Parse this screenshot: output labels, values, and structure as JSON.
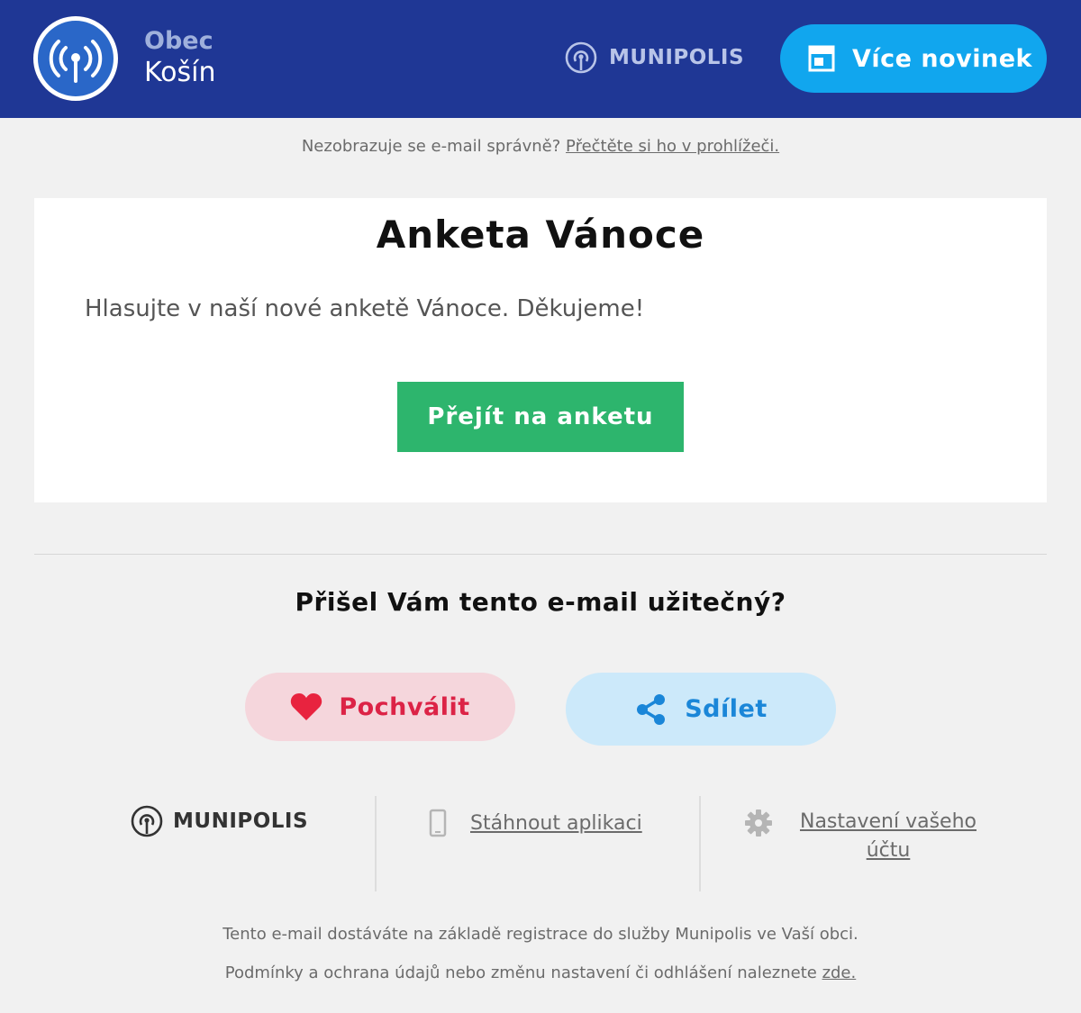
{
  "header": {
    "brand_top": "Obec",
    "brand_bottom": "Košín",
    "munipolis_label": "MUNIPOLIS",
    "more_news_label": "Více novinek",
    "icons": {
      "logo": "broadcast-antenna-icon",
      "munipolis": "munipolis-logo-icon",
      "more_news": "newspaper-icon"
    }
  },
  "browser_note": {
    "text": "Nezobrazuje se e-mail správně?",
    "link": "Přečtěte si ho v prohlížeči."
  },
  "card": {
    "title": "Anketa Vánoce",
    "text": "Hlasujte v naší nové anketě Vánoce. Děkujeme!",
    "cta_label": "Přejít na anketu"
  },
  "feedback": {
    "question": "Přišel Vám tento e-mail užitečný?",
    "like_label": "Pochválit",
    "share_label": "Sdílet",
    "icons": {
      "like": "heart-icon",
      "share": "share-icon"
    }
  },
  "footer": {
    "munipolis_label": "MUNIPOLIS",
    "app_link": "Stáhnout aplikaci",
    "settings_link": "Nastavení vašeho účtu",
    "legal_line1": "Tento e-mail dostáváte na základě registrace do služby Munipolis ve Vaší obci.",
    "legal_line2": "Podmínky a ochrana údajů nebo změnu nastavení či odhlášení naleznete",
    "legal_link": "zde.",
    "icons": {
      "app": "smartphone-icon",
      "settings": "gear-icon"
    }
  },
  "colors": {
    "header_bg": "#1f3795",
    "more_news_bg": "#11a6ee",
    "cta_bg": "#2db56d",
    "like_bg": "#f5d6dc",
    "like_text": "#dc2346",
    "share_bg": "#cce9fa",
    "share_text": "#1a86d8"
  }
}
